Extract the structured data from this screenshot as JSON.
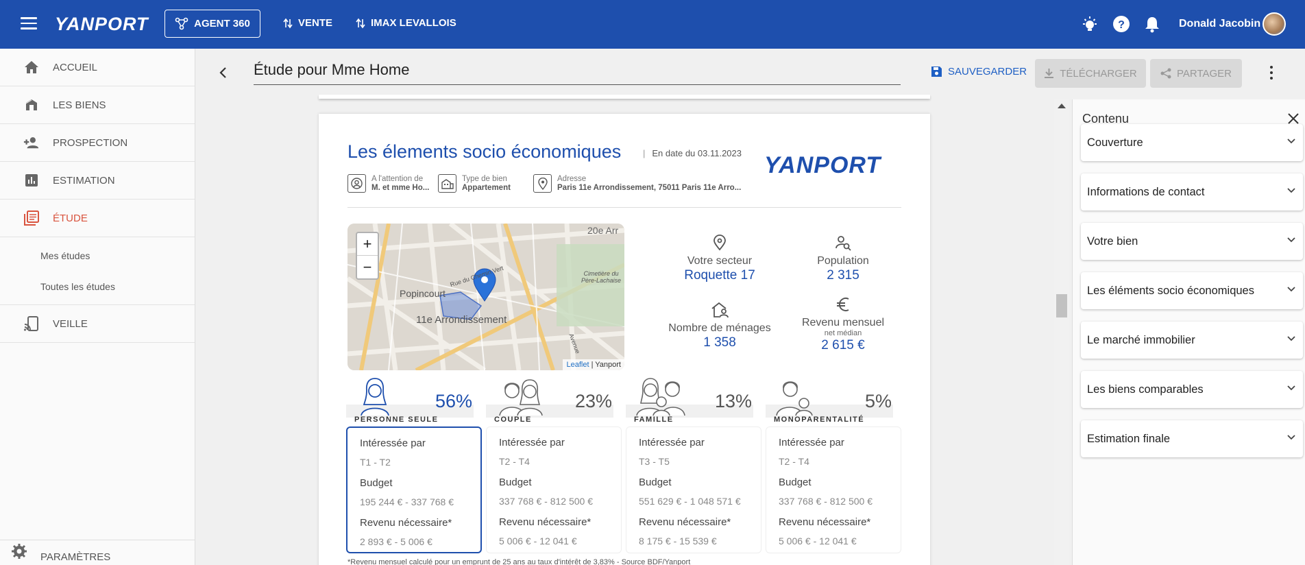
{
  "topbar": {
    "logo": "YANPORT",
    "agent_button": "AGENT 360",
    "link_vente": "VENTE",
    "link_imax": "IMAX LEVALLOIS",
    "user_name": "Donald Jacobin",
    "bg_color": "#1e4fad"
  },
  "sidebar": {
    "items": [
      {
        "label": "ACCUEIL",
        "icon": "home-icon"
      },
      {
        "label": "LES BIENS",
        "icon": "properties-icon"
      },
      {
        "label": "PROSPECTION",
        "icon": "person-add-icon"
      },
      {
        "label": "ESTIMATION",
        "icon": "bar-chart-icon"
      },
      {
        "label": "ÉTUDE",
        "icon": "study-icon",
        "active": true
      },
      {
        "label": "VEILLE",
        "icon": "cast-icon"
      }
    ],
    "sub_items": [
      "Mes études",
      "Toutes les études"
    ],
    "settings_label": "PARAMÈTRES",
    "active_color": "#d9533e"
  },
  "header": {
    "title": "Étude pour Mme Home",
    "save_label": "SAUVEGARDER",
    "download_label": "TÉLÉCHARGER",
    "share_label": "PARTAGER"
  },
  "doc": {
    "title": "Les élements socio économiques",
    "date": "En date du 03.11.2023",
    "logo": "YANPORT",
    "meta": {
      "attention_key": "A l'attention de",
      "attention_val": "M. et mme Ho...",
      "type_key": "Type de bien",
      "type_val": "Appartement",
      "address_key": "Adresse",
      "address_val": "Paris 11e Arrondissement, 75011 Paris 11e Arro..."
    },
    "map": {
      "zoom_in": "+",
      "zoom_out": "−",
      "labels": [
        "20e Arr",
        "Popincourt",
        "Rue du Chemin Vert",
        "Cimetière du Père-Lachaise",
        "11e Arrondissement",
        "Avenue"
      ],
      "attribution_link": "Leaflet",
      "attribution_text": "| Yanport"
    },
    "stats": {
      "sector_label": "Votre secteur",
      "sector_value": "Roquette 17",
      "population_label": "Population",
      "population_value": "2 315",
      "households_label": "Nombre de ménages",
      "households_value": "1 358",
      "income_label": "Revenu mensuel",
      "income_sub": "net médian",
      "income_value": "2 615 €"
    },
    "households": [
      {
        "name": "PERSONNE SEULE",
        "pct": "56%",
        "interest_label": "Intéressée par",
        "interest": "T1 - T2",
        "budget_label": "Budget",
        "budget": "195 244 € - 337 768 €",
        "income_label": "Revenu nécessaire*",
        "income": "2 893 € - 5 006 €"
      },
      {
        "name": "COUPLE",
        "pct": "23%",
        "interest_label": "Intéressée par",
        "interest": "T2 - T4",
        "budget_label": "Budget",
        "budget": "337 768 € - 812 500 €",
        "income_label": "Revenu nécessaire*",
        "income": "5 006 € - 12 041 €"
      },
      {
        "name": "FAMILLE",
        "pct": "13%",
        "interest_label": "Intéressée par",
        "interest": "T3 - T5",
        "budget_label": "Budget",
        "budget": "551 629 € - 1 048 571 €",
        "income_label": "Revenu nécessaire*",
        "income": "8 175 € - 15 539 €"
      },
      {
        "name": "MONOPARENTALITÉ",
        "pct": "5%",
        "interest_label": "Intéressée par",
        "interest": "T2 - T4",
        "budget_label": "Budget",
        "budget": "337 768 € - 812 500 €",
        "income_label": "Revenu nécessaire*",
        "income": "5 006 € - 12 041 €"
      }
    ],
    "footnote": "*Revenu mensuel calculé pour un emprunt de 25 ans au taux d'intérêt de 3,83% - Source BDF/Yanport"
  },
  "panel": {
    "title": "Contenu",
    "sections": [
      "Couverture",
      "Informations de contact",
      "Votre bien",
      "Les éléments socio économiques",
      "Le marché immobilier",
      "Les biens comparables",
      "Estimation finale"
    ]
  }
}
